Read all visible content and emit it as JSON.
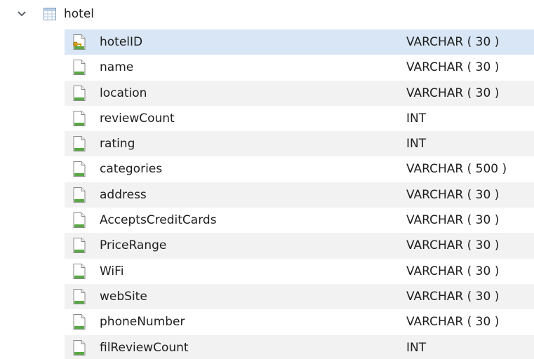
{
  "table": {
    "name": "hotel",
    "expanded_icon": "chevron-down-icon",
    "icon": "table-icon"
  },
  "columns": [
    {
      "name": "hotelID",
      "type": "VARCHAR ( 30 )",
      "icon": "primary-key-column-icon",
      "selected": true
    },
    {
      "name": "name",
      "type": "VARCHAR ( 30 )",
      "icon": "column-icon"
    },
    {
      "name": "location",
      "type": "VARCHAR ( 30 )",
      "icon": "column-icon"
    },
    {
      "name": "reviewCount",
      "type": "INT",
      "icon": "column-icon"
    },
    {
      "name": "rating",
      "type": "INT",
      "icon": "column-icon"
    },
    {
      "name": "categories",
      "type": "VARCHAR ( 500 )",
      "icon": "column-icon"
    },
    {
      "name": "address",
      "type": "VARCHAR ( 30 )",
      "icon": "column-icon"
    },
    {
      "name": "AcceptsCreditCards",
      "type": "VARCHAR ( 30 )",
      "icon": "column-icon"
    },
    {
      "name": "PriceRange",
      "type": "VARCHAR ( 30 )",
      "icon": "column-icon"
    },
    {
      "name": "WiFi",
      "type": "VARCHAR ( 30 )",
      "icon": "column-icon"
    },
    {
      "name": "webSite",
      "type": "VARCHAR ( 30 )",
      "icon": "column-icon"
    },
    {
      "name": "phoneNumber",
      "type": "VARCHAR ( 30 )",
      "icon": "column-icon"
    },
    {
      "name": "filReviewCount",
      "type": "INT",
      "icon": "column-icon"
    }
  ],
  "colors": {
    "selected_row": "#d9e6f6",
    "alt_row": "#f2f2f2",
    "column_icon_bar": "#5aa845",
    "key_icon": "#d4a017"
  }
}
